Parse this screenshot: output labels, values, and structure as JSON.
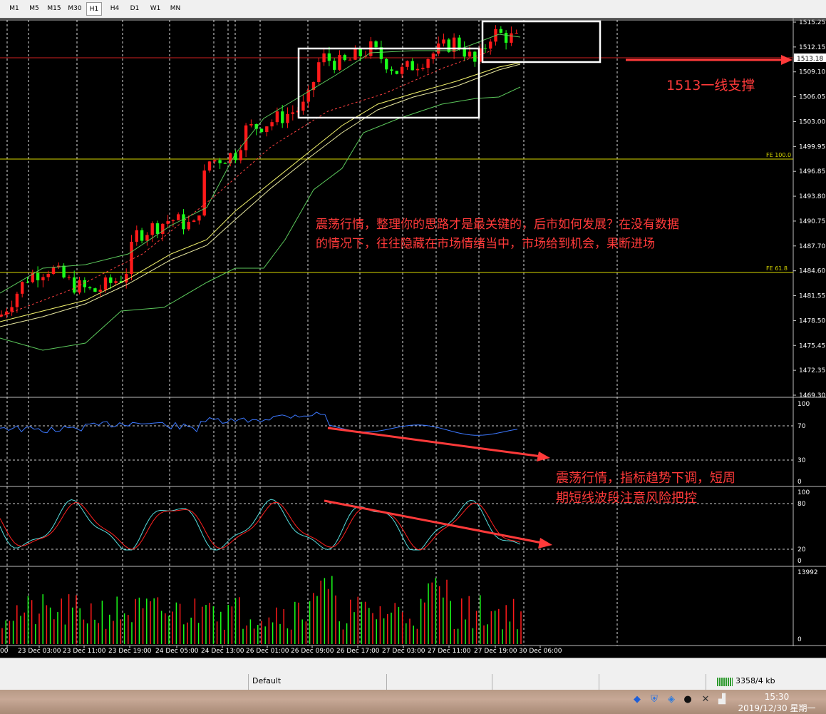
{
  "toolbar": {
    "timeframes": [
      {
        "label": "M1",
        "active": false
      },
      {
        "label": "M5",
        "active": false
      },
      {
        "label": "M15",
        "active": false
      },
      {
        "label": "M30",
        "active": false
      },
      {
        "label": "H1",
        "active": true
      },
      {
        "label": "H4",
        "active": false
      },
      {
        "label": "D1",
        "active": false
      },
      {
        "label": "W1",
        "active": false
      },
      {
        "label": "MN",
        "active": false
      }
    ]
  },
  "price_axis": {
    "labels": [
      "1515.25",
      "1512.15",
      "1509.10",
      "1506.05",
      "1503.00",
      "1499.95",
      "1496.85",
      "1493.80",
      "1490.75",
      "1487.70",
      "1484.60",
      "1481.55",
      "1478.50",
      "1475.45",
      "1472.35",
      "1469.30"
    ],
    "current_price": "1513.18"
  },
  "fib_levels": [
    {
      "label": "FE 100.0"
    },
    {
      "label": "FE 61.8"
    }
  ],
  "rsi_axis": [
    "100",
    "70",
    "30",
    "0"
  ],
  "stoch_axis": [
    "100",
    "80",
    "20",
    "0"
  ],
  "volume_axis": [
    "13992",
    "0"
  ],
  "time_axis": [
    "00",
    "23 Dec 03:00",
    "23 Dec 11:00",
    "23 Dec 19:00",
    "24 Dec 05:00",
    "24 Dec 13:00",
    "26 Dec 01:00",
    "26 Dec 09:00",
    "26 Dec 17:00",
    "27 Dec 03:00",
    "27 Dec 11:00",
    "27 Dec 19:00",
    "30 Dec 06:00"
  ],
  "annotations": {
    "support": "1513一线支撑",
    "main": "震荡行情，整理你的思路才是最关键的，后市如何发展？在没有数据的情况下，往往隐藏在市场情绪当中，市场给到机会，果断进场",
    "indicator": "震荡行情，指标趋势下调，短周期短线波段注意风险把控"
  },
  "status": {
    "profile": "Default",
    "traffic": "3358/4 kb"
  },
  "taskbar": {
    "time": "15:30",
    "date": "2019/12/30 星期一"
  },
  "colors": {
    "bull": "#ff1a1a",
    "bear": "#1aff1a",
    "accent_red": "#ff3a3a",
    "fib": "#d8d800",
    "ma_yellow": "#f5f56e",
    "bollinger": "#5cc95c",
    "rsi": "#3c78ff",
    "stoch_main": "#55dddd",
    "stoch_signal": "#ff2020"
  }
}
